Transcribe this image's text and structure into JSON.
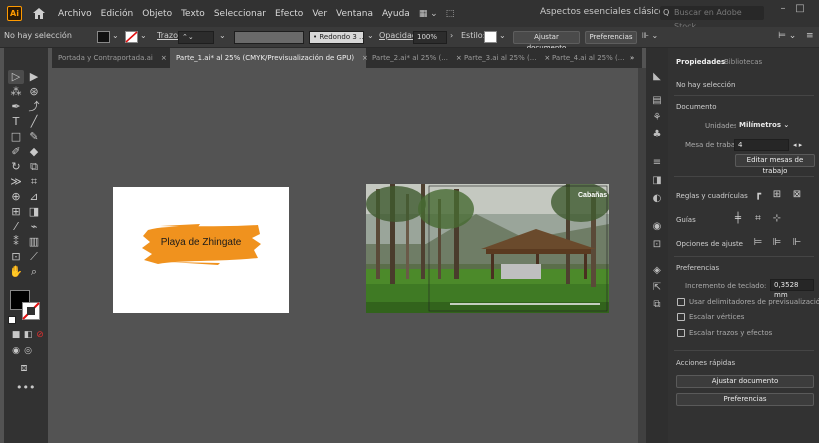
{
  "app": {
    "logo": "Ai"
  },
  "menubar": {
    "items": [
      "Archivo",
      "Edición",
      "Objeto",
      "Texto",
      "Seleccionar",
      "Efecto",
      "Ver",
      "Ventana",
      "Ayuda"
    ],
    "workspace": "Aspectos esenciales clásicos",
    "stock_placeholder": "Buscar en Adobe Stock"
  },
  "control": {
    "selection": "No hay selección",
    "stroke_label": "Trazo:",
    "brush": "Redondo 3 ...",
    "opacity_label": "Opacidad:",
    "opacity_value": "100%",
    "style_label": "Estilo:",
    "fit_doc": "Ajustar documento",
    "prefs": "Preferencias"
  },
  "tabs": [
    {
      "label": "Portada y Contraportada.ai",
      "active": false
    },
    {
      "label": "Parte_1.ai* al 25% (CMYK/Previsualización de GPU)",
      "active": true
    },
    {
      "label": "Parte_2.ai* al 25% (...",
      "active": false
    },
    {
      "label": "Parte_3.ai al 25% (...",
      "active": false
    },
    {
      "label": "Parte_4.ai al 25% (...",
      "active": false
    }
  ],
  "artboard1": {
    "text": "Playa de Zhingate",
    "brush_color": "#f0921e"
  },
  "artboard2": {
    "text": "Cabañas"
  },
  "panel": {
    "tab_properties": "Propiedades",
    "tab_libraries": "Bibliotecas",
    "no_selection": "No hay selección",
    "document": "Documento",
    "units_label": "Unidades:",
    "units_value": "Milímetros",
    "artboard_label": "Mesa de trabajo:",
    "artboard_value": "4",
    "edit_artboards": "Editar mesas de trabajo",
    "rulers_grids": "Reglas y cuadrículas",
    "guides": "Guías",
    "snap_options": "Opciones de ajuste",
    "preferences": "Preferencias",
    "keyboard_increment_label": "Incremento de teclado:",
    "keyboard_increment_value": "0,3528 mm",
    "use_preview_bounds": "Usar delimitadores de previsualización",
    "scale_corners": "Escalar vértices",
    "scale_strokes": "Escalar trazos y efectos",
    "quick_actions": "Acciones rápidas",
    "fit_document": "Ajustar documento",
    "preferences_btn": "Preferencias"
  }
}
